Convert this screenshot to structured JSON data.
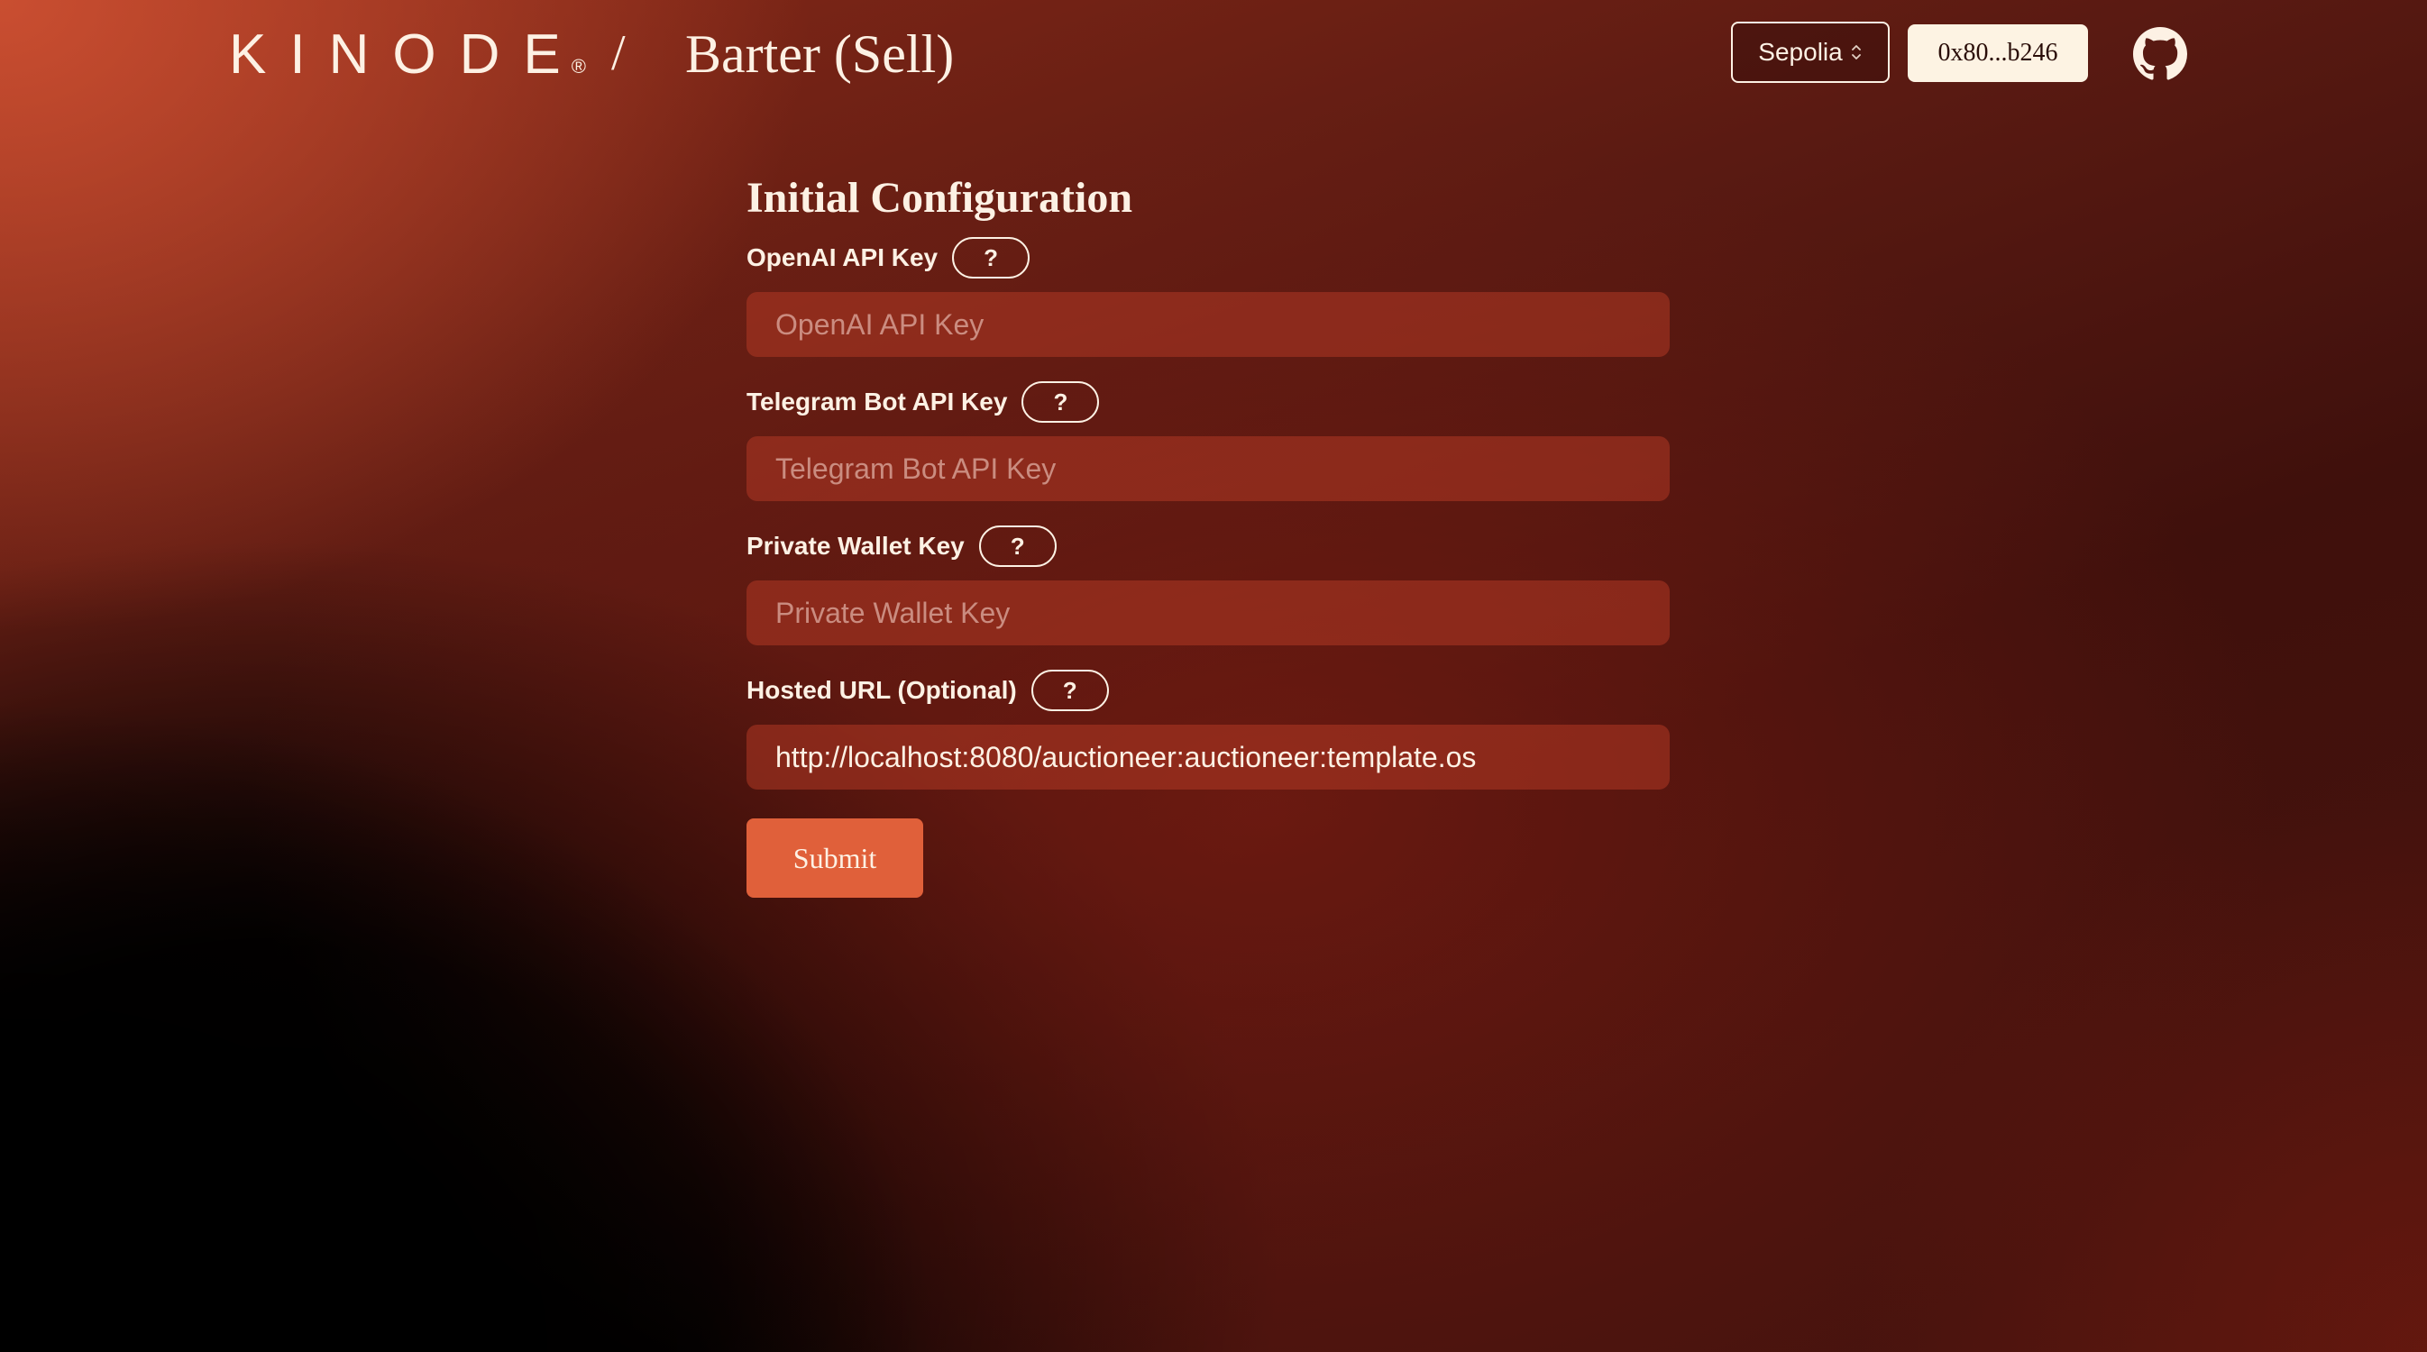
{
  "header": {
    "logo_text": "KINODE",
    "logo_mark": "®",
    "separator": "/",
    "app_title": "Barter (Sell)",
    "network": {
      "selected": "Sepolia",
      "icon": "chevron-up-down-icon"
    },
    "wallet_address": "0x80...b246",
    "github_icon": "github-icon"
  },
  "form": {
    "title": "Initial Configuration",
    "help_label": "?",
    "fields": [
      {
        "label": "OpenAI API Key",
        "placeholder": "OpenAI API Key",
        "value": ""
      },
      {
        "label": "Telegram Bot API Key",
        "placeholder": "Telegram Bot API Key",
        "value": ""
      },
      {
        "label": "Private Wallet Key",
        "placeholder": "Private Wallet Key",
        "value": ""
      },
      {
        "label": "Hosted URL (Optional)",
        "placeholder": "",
        "value": "http://localhost:8080/auctioneer:auctioneer:template.os"
      }
    ],
    "submit_label": "Submit"
  },
  "colors": {
    "accent": "#e0603a",
    "text": "#fdf1e4",
    "wallet_bg": "#fdf3e3",
    "input_bg": "#8f2c1c"
  }
}
